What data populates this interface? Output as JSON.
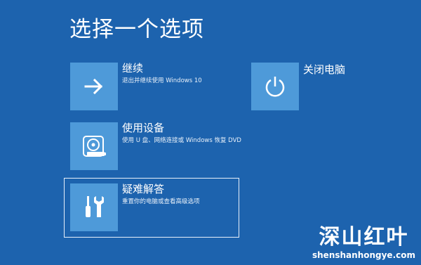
{
  "page": {
    "title": "选择一个选项"
  },
  "options": {
    "continue": {
      "label": "继续",
      "description": "退出并继续使用 Windows 10",
      "icon": "arrow-right-icon"
    },
    "use_device": {
      "label": "使用设备",
      "description": "使用 U 盘、网络连接或 Windows 恢复 DVD",
      "icon": "disc-drive-icon"
    },
    "troubleshoot": {
      "label": "疑难解答",
      "description": "重置你的电脑或查看高级选项",
      "icon": "tools-icon"
    },
    "shutdown": {
      "label": "关闭电脑",
      "icon": "power-icon"
    }
  },
  "watermark": {
    "brand": "深山红叶",
    "url": "shenshanhongye.com"
  },
  "colors": {
    "background": "#1d63ae",
    "tile": "#4e9ad9",
    "text": "#ffffff"
  }
}
